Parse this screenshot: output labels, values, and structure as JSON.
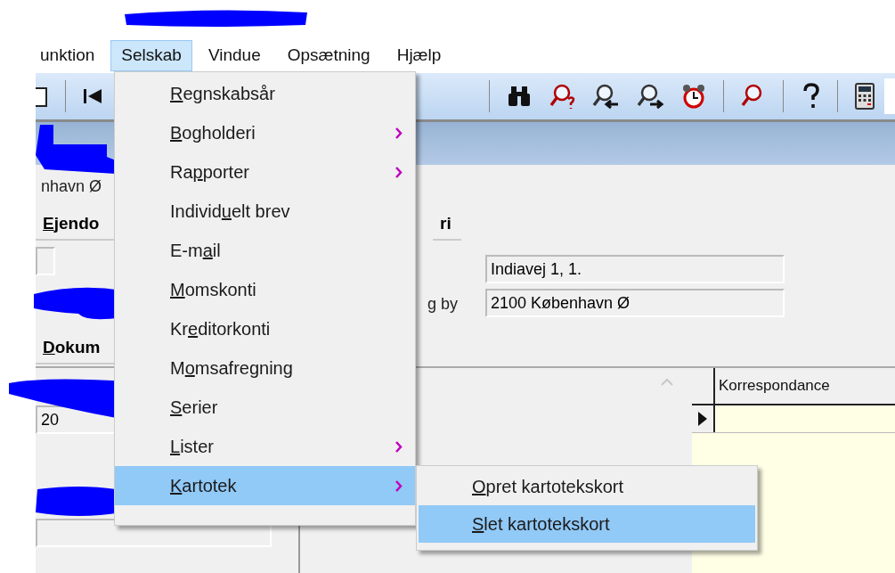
{
  "menubar": [
    {
      "label": "unktion",
      "selected": false
    },
    {
      "label": "Selskab",
      "selected": true
    },
    {
      "label": "Vindue",
      "selected": false
    },
    {
      "label": "Opsætning",
      "selected": false
    },
    {
      "label": "Hjælp",
      "selected": false
    }
  ],
  "menu": [
    {
      "key": "R",
      "post": "egnskabsår",
      "has_submenu": false,
      "selected": false
    },
    {
      "key": "B",
      "post": "ogholderi",
      "has_submenu": true,
      "selected": false
    },
    {
      "pre": "Ra",
      "key": "p",
      "post": "porter",
      "has_submenu": true,
      "selected": false
    },
    {
      "pre": "Individ",
      "key": "u",
      "post": "elt brev",
      "has_submenu": false,
      "selected": false
    },
    {
      "pre": "E-m",
      "key": "a",
      "post": "il",
      "has_submenu": false,
      "selected": false
    },
    {
      "key": "M",
      "post": "omskonti",
      "has_submenu": false,
      "selected": false
    },
    {
      "pre": "Kr",
      "key": "e",
      "post": "ditorkonti",
      "has_submenu": false,
      "selected": false
    },
    {
      "pre": "M",
      "key": "o",
      "post": "msafregning",
      "has_submenu": false,
      "selected": false
    },
    {
      "key": "S",
      "post": "erier",
      "has_submenu": false,
      "selected": false
    },
    {
      "key": "L",
      "post": "ister",
      "has_submenu": true,
      "selected": false
    },
    {
      "key": "K",
      "post": "artotek",
      "has_submenu": true,
      "selected": true
    }
  ],
  "submenu": [
    {
      "key": "O",
      "post": "pret kartotekskort",
      "selected": false
    },
    {
      "key": "S",
      "post": "let kartotekskort",
      "selected": true
    }
  ],
  "form": {
    "partial_text": "nhavn Ø",
    "tabs_top": [
      {
        "key": "E",
        "post": "jendo"
      },
      {
        "post": "ri"
      }
    ],
    "address_label": "g by",
    "address": [
      "Indiavej 1, 1.",
      "2100 København Ø"
    ],
    "tabs_bottom": [
      {
        "key": "D",
        "post": "okum"
      }
    ],
    "field_value": "20",
    "grid": {
      "columns": [
        "Korrespondance"
      ],
      "rows": [
        {
          "current": true
        }
      ]
    }
  }
}
